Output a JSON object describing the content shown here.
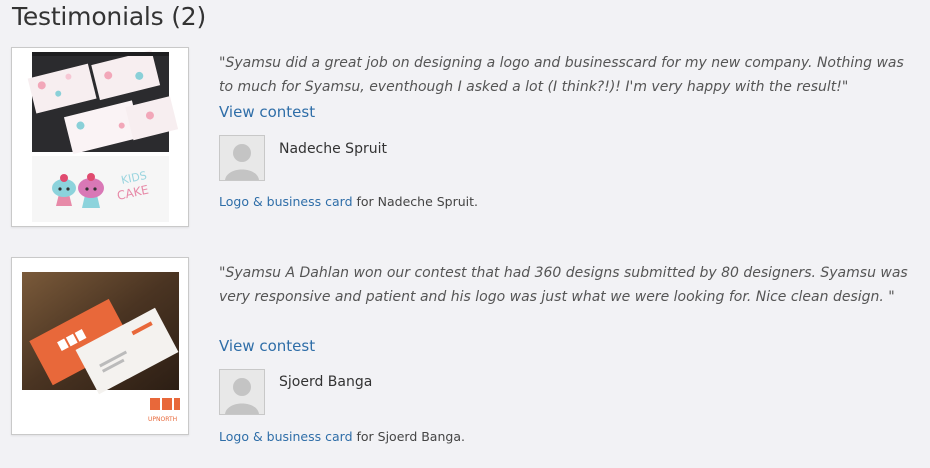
{
  "page": {
    "heading": "Testimonials (2)"
  },
  "testimonials": [
    {
      "quote": "\"Syamsu did a great job on designing a logo and businesscard for my new company. Nothing was to much for Syamsu, eventhough I asked a lot (I think?!)! I'm very happy with the result!\"",
      "view_contest": "View contest",
      "author": "Nadeche Spruit",
      "project_link": "Logo & business card",
      "project_suffix": " for Nadeche Spruit."
    },
    {
      "quote": "\"Syamsu A Dahlan won our contest that had 360 designs submitted by 80 designers. Syamsu was very responsive and patient and his logo was just what we were looking for. Nice clean design. \"",
      "view_contest": "View contest",
      "author": "Sjoerd Banga",
      "project_link": "Logo & business card",
      "project_suffix": " for Sjoerd Banga."
    }
  ],
  "images": {
    "logo1_text": "KIDS CAKE",
    "logo2_text": "UPNORTH"
  },
  "colors": {
    "link": "#2f6ea8",
    "background": "#f2f2f5"
  }
}
